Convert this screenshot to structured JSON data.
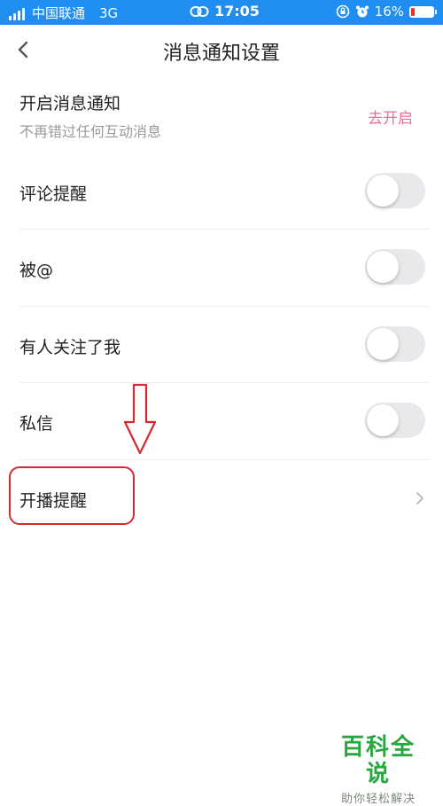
{
  "status_bar": {
    "carrier": "中国联通",
    "network": "3G",
    "time": "17:05",
    "battery": "16%",
    "battery_level": 0.16,
    "colors": {
      "background": "#1f8ef0",
      "battery_low": "#e8342d"
    }
  },
  "nav": {
    "title": "消息通知设置",
    "back_icon": "chevron-left-icon"
  },
  "notification_master": {
    "title": "开启消息通知",
    "subtitle": "不再错过任何互动消息",
    "action_label": "去开启",
    "action_color": "#f26a9a"
  },
  "settings": [
    {
      "label": "评论提醒",
      "enabled": false
    },
    {
      "label": "被@",
      "enabled": false
    },
    {
      "label": "有人关注了我",
      "enabled": false
    },
    {
      "label": "私信",
      "enabled": false
    }
  ],
  "live_reminder": {
    "label": "开播提醒",
    "icon": "chevron-right-icon"
  },
  "annotation": {
    "color": "#d9272f",
    "arrow_icon": "down-arrow-outline-icon"
  },
  "watermark": {
    "brand": "百科全说",
    "tagline": "助你轻松解决",
    "color": "#27a83f"
  }
}
